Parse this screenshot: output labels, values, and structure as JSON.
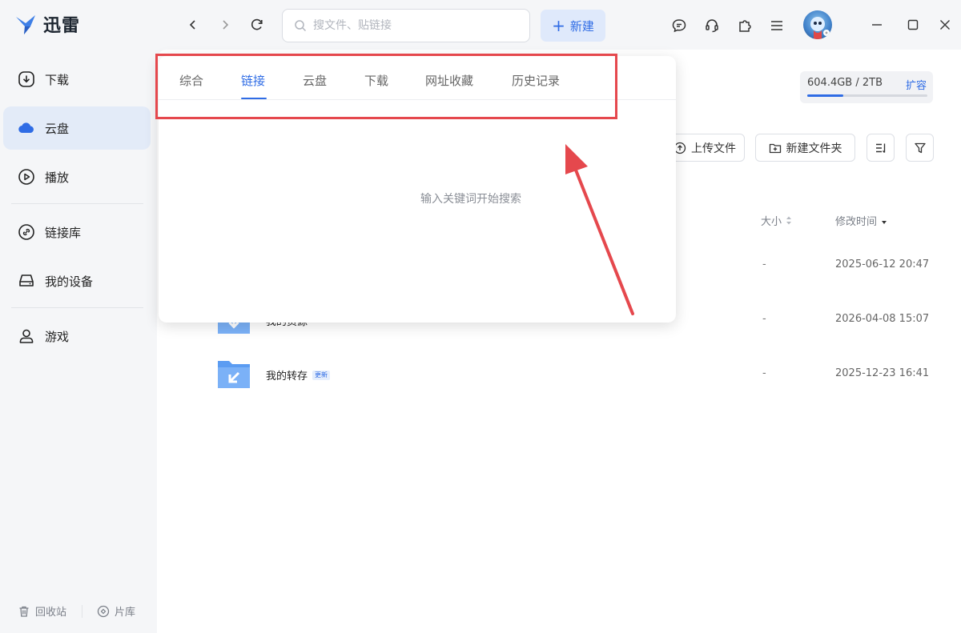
{
  "app": {
    "logo_text": "迅雷"
  },
  "search": {
    "placeholder": "搜文件、贴链接"
  },
  "toolbar": {
    "new_label": "新建"
  },
  "sidebar": {
    "items": [
      {
        "label": "下载",
        "icon": "download-circle-icon"
      },
      {
        "label": "云盘",
        "icon": "cloud-icon"
      },
      {
        "label": "播放",
        "icon": "play-circle-icon"
      },
      {
        "label": "链接库",
        "icon": "link-icon"
      },
      {
        "label": "我的设备",
        "icon": "device-icon"
      },
      {
        "label": "游戏",
        "icon": "user-icon"
      }
    ],
    "active": "云盘",
    "bottom": [
      {
        "label": "回收站",
        "icon": "trash-icon"
      },
      {
        "label": "片库",
        "icon": "film-icon"
      }
    ]
  },
  "storage": {
    "text": "604.4GB / 2TB",
    "expand_label": "扩容",
    "used_fraction": 0.302
  },
  "actions": {
    "upload_label": "上传文件",
    "new_folder_label": "新建文件夹"
  },
  "table": {
    "col_size": "大小",
    "col_modified": "修改时间",
    "rows": [
      {
        "name": "",
        "size": "-",
        "modified": "2025-06-12 20:47",
        "badge": ""
      },
      {
        "name": "我的资源",
        "size": "-",
        "modified": "2026-04-08 15:07",
        "badge": ""
      },
      {
        "name": "我的转存",
        "size": "-",
        "modified": "2025-12-23 16:41",
        "badge": "更新"
      }
    ]
  },
  "dropdown": {
    "tabs": [
      "综合",
      "链接",
      "云盘",
      "下载",
      "网址收藏",
      "历史记录"
    ],
    "active_tab": "链接",
    "empty_text": "输入关键词开始搜索"
  },
  "colors": {
    "accent": "#2f6ce5",
    "highlight": "#e5484d",
    "folder": "#5b9cf2"
  }
}
